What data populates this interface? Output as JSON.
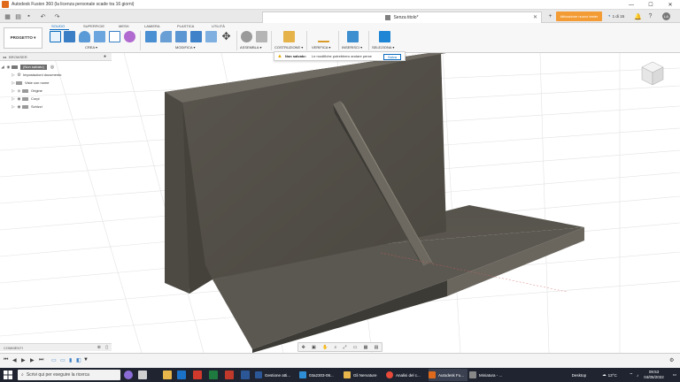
{
  "title_bar": {
    "title": "Autodesk Fusion 360 (la licenza personale scade tra 16 giorni)",
    "minimize": "—",
    "maximize": "☐",
    "close": "✕"
  },
  "tab_bar": {
    "document_title": "Senza titolo*",
    "activate_label": "Attivazione nuovo tester",
    "job_status": "1 di 15"
  },
  "ribbon": {
    "workspace": "PROGETTO ▾",
    "tabs": [
      "SOLIDO",
      "SUPERFICIE",
      "MESH",
      "LAMIERA",
      "PLASTICA",
      "UTILITÀ"
    ],
    "groups": [
      "CREA ▾",
      "MODIFICA ▾",
      "ASSEMBLA ▾",
      "COSTRUZIONE ▾",
      "VERIFICA ▾",
      "INSERISCI ▾",
      "SELEZIONA ▾"
    ]
  },
  "warning": {
    "title": "Non salvato:",
    "message": "Le modifiche potrebbero andare perse",
    "save": "Salva"
  },
  "browser": {
    "header": "BROWSER",
    "root": "(Non salvato)",
    "items": [
      "Impostazioni documento",
      "Viste con nome",
      "Origine",
      "Corpi",
      "Schizzi"
    ]
  },
  "comments": {
    "label": "COMMENTI"
  },
  "taskbar": {
    "search_placeholder": "Scrivi qui per eseguire la ricerca",
    "apps": [
      "Gestione atti...",
      "03a2303-08...",
      "Gli Nervature",
      "Analisi del c...",
      "Autodesk Fu...",
      "Miniatura - ..."
    ],
    "desktop": "Desktop",
    "weather": "13°C",
    "time": "09:53",
    "date": "04/05/2022"
  },
  "colors": {
    "accent": "#0b6bbf",
    "activate": "#f39b34",
    "model_dark": "#4e4b45",
    "model_mid": "#6b675f",
    "model_light": "#7a766d"
  }
}
